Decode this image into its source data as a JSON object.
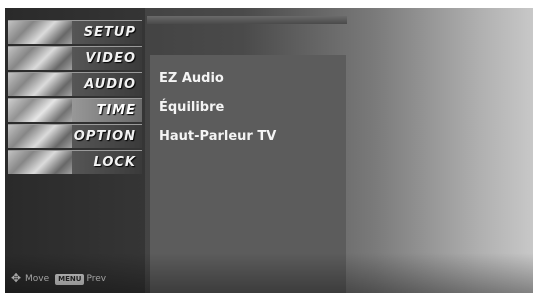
{
  "menu": {
    "items": [
      {
        "label": "SETUP"
      },
      {
        "label": "VIDEO"
      },
      {
        "label": "AUDIO"
      },
      {
        "label": "TIME"
      },
      {
        "label": "OPTION"
      },
      {
        "label": "LOCK"
      }
    ],
    "selected": "TIME"
  },
  "footer": {
    "move_label": "Move",
    "prev_key": "MENU",
    "prev_label": "Prev"
  },
  "submenu": {
    "items": [
      {
        "label": "EZ Audio"
      },
      {
        "label": "Équilibre"
      },
      {
        "label": "Haut-Parleur TV"
      }
    ]
  }
}
